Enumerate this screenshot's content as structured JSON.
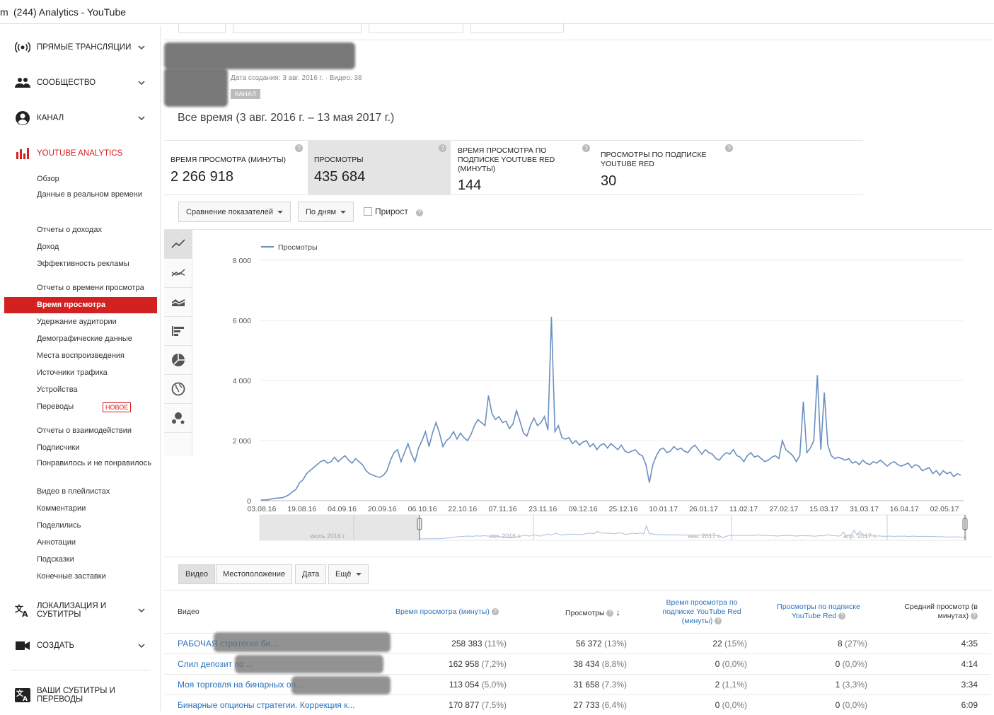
{
  "window": {
    "title": "(244) Analytics - YouTube",
    "title_prefix": "m"
  },
  "sidebar": {
    "sections": [
      {
        "label": "ПРЯМЫЕ ТРАНСЛЯЦИИ",
        "icon": "live-icon"
      },
      {
        "label": "СООБЩЕСТВО",
        "icon": "people-icon"
      },
      {
        "label": "КАНАЛ",
        "icon": "account-icon"
      },
      {
        "label": "YOUTUBE ANALYTICS",
        "icon": "analytics-icon"
      },
      {
        "label": "ЛОКАЛИЗАЦИЯ И СУБТИТРЫ",
        "icon": "translate-icon"
      },
      {
        "label": "СОЗДАТЬ",
        "icon": "video-camera-icon"
      },
      {
        "label": "ВАШИ СУБТИТРЫ И ПЕРЕВОДЫ",
        "icon": "translate-icon"
      }
    ],
    "analytics_items": [
      "Обзор",
      "Данные в реальном времени",
      "Отчеты о доходах",
      "Доход",
      "Эффективность рекламы",
      "Отчеты о времени просмотра",
      "Время просмотра",
      "Удержание аудитории",
      "Демографические данные",
      "Места воспроизведения",
      "Источники трафика",
      "Устройства",
      "Переводы",
      "Отчеты о взаимодействии",
      "Подписчики",
      "Понравилось и не понравилось",
      "Видео в плейлистах",
      "Комментарии",
      "Поделились",
      "Аннотации",
      "Подсказки",
      "Конечные заставки"
    ],
    "new_badge": "НОВОЕ",
    "active_item": "Время просмотра"
  },
  "channel": {
    "meta": "Дата создания: 3 авг. 2016 г. · Видео: 38",
    "badge": "КАНАЛ",
    "range": "Все время (3 авг. 2016 г. – 13 мая 2017 г.)"
  },
  "metrics": [
    {
      "title": "ВРЕМЯ ПРОСМОТРА (МИНУТЫ)",
      "value": "2 266 918",
      "selected": false
    },
    {
      "title": "ПРОСМОТРЫ",
      "value": "435 684",
      "selected": true
    },
    {
      "title": "ВРЕМЯ ПРОСМОТРА ПО ПОДПИСКЕ YOUTUBE RED (МИНУТЫ)",
      "value": "144",
      "selected": false
    },
    {
      "title": "ПРОСМОТРЫ ПО ПОДПИСКЕ YOUTUBE RED",
      "value": "30",
      "selected": false
    }
  ],
  "controls": {
    "compare": "Сравнение показателей",
    "period": "По дням",
    "growth": "Прирост"
  },
  "chart_tools": [
    "line-chart-icon",
    "multi-line-icon",
    "area-chart-icon",
    "bar-chart-icon",
    "pie-chart-icon",
    "globe-icon",
    "bubble-chart-icon"
  ],
  "chart_data": {
    "type": "line",
    "legend": "Просмотры",
    "series": [
      {
        "name": "Просмотры",
        "color": "#6a8fc0",
        "values": [
          20,
          25,
          30,
          60,
          80,
          90,
          100,
          140,
          200,
          300,
          380,
          600,
          700,
          900,
          1000,
          1100,
          1200,
          1300,
          1350,
          1250,
          1300,
          1450,
          1300,
          1400,
          1500,
          1350,
          1250,
          1400,
          1300,
          1200,
          1000,
          900,
          850,
          800,
          780,
          850,
          1000,
          1350,
          1600,
          1700,
          1300,
          1600,
          1900,
          1550,
          1300,
          1750,
          2000,
          2300,
          1800,
          2250,
          2600,
          2250,
          1800,
          2000,
          2100,
          2300,
          2050,
          2250,
          2100,
          2000,
          2200,
          2500,
          2700,
          2600,
          2500,
          3500,
          2900,
          2700,
          2800,
          2600,
          2650,
          2400,
          2550,
          3000,
          2650,
          2250,
          2150,
          2500,
          2750,
          2500,
          2600,
          2800,
          2350,
          6120,
          2300,
          2500,
          2100,
          2050,
          2100,
          1900,
          2000,
          1850,
          1950,
          2000,
          1800,
          1900,
          1700,
          1850,
          1900,
          1750,
          1900,
          1800,
          1700,
          1850,
          1650,
          1600,
          1650,
          1700,
          1550,
          1500,
          1200,
          600,
          1200,
          1500,
          1700,
          1750,
          1600,
          1650,
          1800,
          1700,
          1750,
          1650,
          1600,
          1750,
          1850,
          1700,
          1550,
          1700,
          1600,
          1550,
          1400,
          1350,
          1500,
          1600,
          1550,
          1700,
          1500,
          1450,
          1300,
          1500,
          1600,
          1450,
          1500,
          1400,
          1300,
          1350,
          1450,
          1500,
          1400,
          2000,
          1700,
          1600,
          1500,
          1300,
          1500,
          3300,
          1600,
          1750,
          2000,
          4180,
          1700,
          3600,
          1850,
          1500,
          1400,
          1450,
          1400,
          1350,
          1400,
          1250,
          1300,
          1200,
          1350,
          1250,
          1200,
          1300,
          1250,
          1350,
          1250,
          1150,
          1250,
          1300,
          1200,
          1150,
          1200,
          1250,
          1100,
          1200,
          1150,
          1000,
          1050,
          1100,
          900,
          1000,
          850,
          1000,
          900,
          950,
          800,
          900,
          850
        ]
      }
    ],
    "x_ticks": [
      "03.08.16",
      "19.08.16",
      "04.09.16",
      "20.09.16",
      "06.10.16",
      "22.10.16",
      "07.11.16",
      "23.11.16",
      "09.12.16",
      "25.12.16",
      "10.01.17",
      "26.01.17",
      "11.02.17",
      "27.02.17",
      "15.03.17",
      "31.03.17",
      "16.04.17",
      "02.05.17"
    ],
    "y_ticks": [
      "0",
      "2 000",
      "4 000",
      "6 000",
      "8 000"
    ],
    "ylim": [
      0,
      8000
    ],
    "navigator_labels": [
      "июль 2016 г.",
      "окт. 2016 г.",
      "янв. 2017 г.",
      "апр. 2017 г."
    ]
  },
  "table": {
    "tabs": [
      "Видео",
      "Местоположение",
      "Дата",
      "Ещё"
    ],
    "headers": {
      "video": "Видео",
      "watch": "Время просмотра (минуты)",
      "views": "Просмотры",
      "red_watch": "Время просмотра по подписке YouTube Red (минуты)",
      "red_views": "Просмотры по подписке YouTube Red",
      "avg": "Средний просмотр (в минутах)"
    },
    "rows": [
      {
        "title": "РАБОЧАЯ стратегия би...",
        "watch": "258 383",
        "watch_p": "(11%)",
        "views": "56 372",
        "views_p": "(13%)",
        "red_watch": "22",
        "red_watch_p": "(15%)",
        "red_views": "8",
        "red_views_p": "(27%)",
        "avg": "4:35"
      },
      {
        "title": "Слил депозит по ...",
        "watch": "162 958",
        "watch_p": "(7,2%)",
        "views": "38 434",
        "views_p": "(8,8%)",
        "red_watch": "0",
        "red_watch_p": "(0,0%)",
        "red_views": "0",
        "red_views_p": "(0,0%)",
        "avg": "4:14"
      },
      {
        "title": "Моя торговля на бинарных оп...",
        "watch": "113 054",
        "watch_p": "(5,0%)",
        "views": "31 658",
        "views_p": "(7,3%)",
        "red_watch": "2",
        "red_watch_p": "(1,1%)",
        "red_views": "1",
        "red_views_p": "(3,3%)",
        "avg": "3:34"
      },
      {
        "title": "Бинарные опционы стратегии. Коррекция к...",
        "watch": "170 877",
        "watch_p": "(7,5%)",
        "views": "27 733",
        "views_p": "(6,4%)",
        "red_watch": "0",
        "red_watch_p": "(0,0%)",
        "red_views": "0",
        "red_views_p": "(0,0%)",
        "avg": "6:09"
      }
    ]
  }
}
